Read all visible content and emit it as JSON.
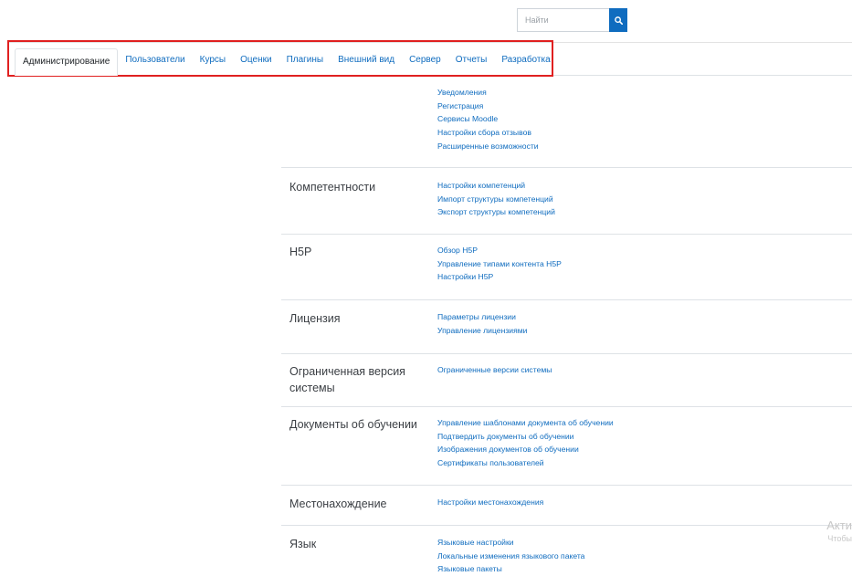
{
  "search": {
    "placeholder": "Найти",
    "icon": "search-icon"
  },
  "tabs": [
    {
      "label": "Администрирование",
      "active": true
    },
    {
      "label": "Пользователи"
    },
    {
      "label": "Курсы"
    },
    {
      "label": "Оценки"
    },
    {
      "label": "Плагины"
    },
    {
      "label": "Внешний вид"
    },
    {
      "label": "Сервер"
    },
    {
      "label": "Отчеты"
    },
    {
      "label": "Разработка"
    }
  ],
  "sections": [
    {
      "heading": "",
      "links": [
        "Уведомления",
        "Регистрация",
        "Сервисы Moodle",
        "Настройки сбора отзывов",
        "Расширенные возможности"
      ]
    },
    {
      "heading": "Компетентности",
      "links": [
        "Настройки компетенций",
        "Импорт структуры компетенций",
        "Экспорт структуры компетенций"
      ]
    },
    {
      "heading": "H5P",
      "links": [
        "Обзор H5P",
        "Управление типами контента H5P",
        "Настройки H5P"
      ]
    },
    {
      "heading": "Лицензия",
      "links": [
        "Параметры лицензии",
        "Управление лицензиями"
      ]
    },
    {
      "heading": "Ограниченная версия системы",
      "links": [
        "Ограниченные версии системы"
      ]
    },
    {
      "heading": "Документы об обучении",
      "links": [
        "Управление шаблонами документа об обучении",
        "Подтвердить документы об обучении",
        "Изображения документов об обучении",
        "Сертификаты пользователей"
      ]
    },
    {
      "heading": "Местонахождение",
      "links": [
        "Настройки местонахождения"
      ]
    },
    {
      "heading": "Язык",
      "links": [
        "Языковые настройки",
        "Локальные изменения языкового пакета",
        "Языковые пакеты"
      ]
    }
  ],
  "watermark": {
    "line1": "Акти",
    "line2": "Чтобы"
  },
  "colors": {
    "link": "#0f6cbf",
    "highlight_border": "#e02020",
    "search_button": "#0f6cbf"
  }
}
